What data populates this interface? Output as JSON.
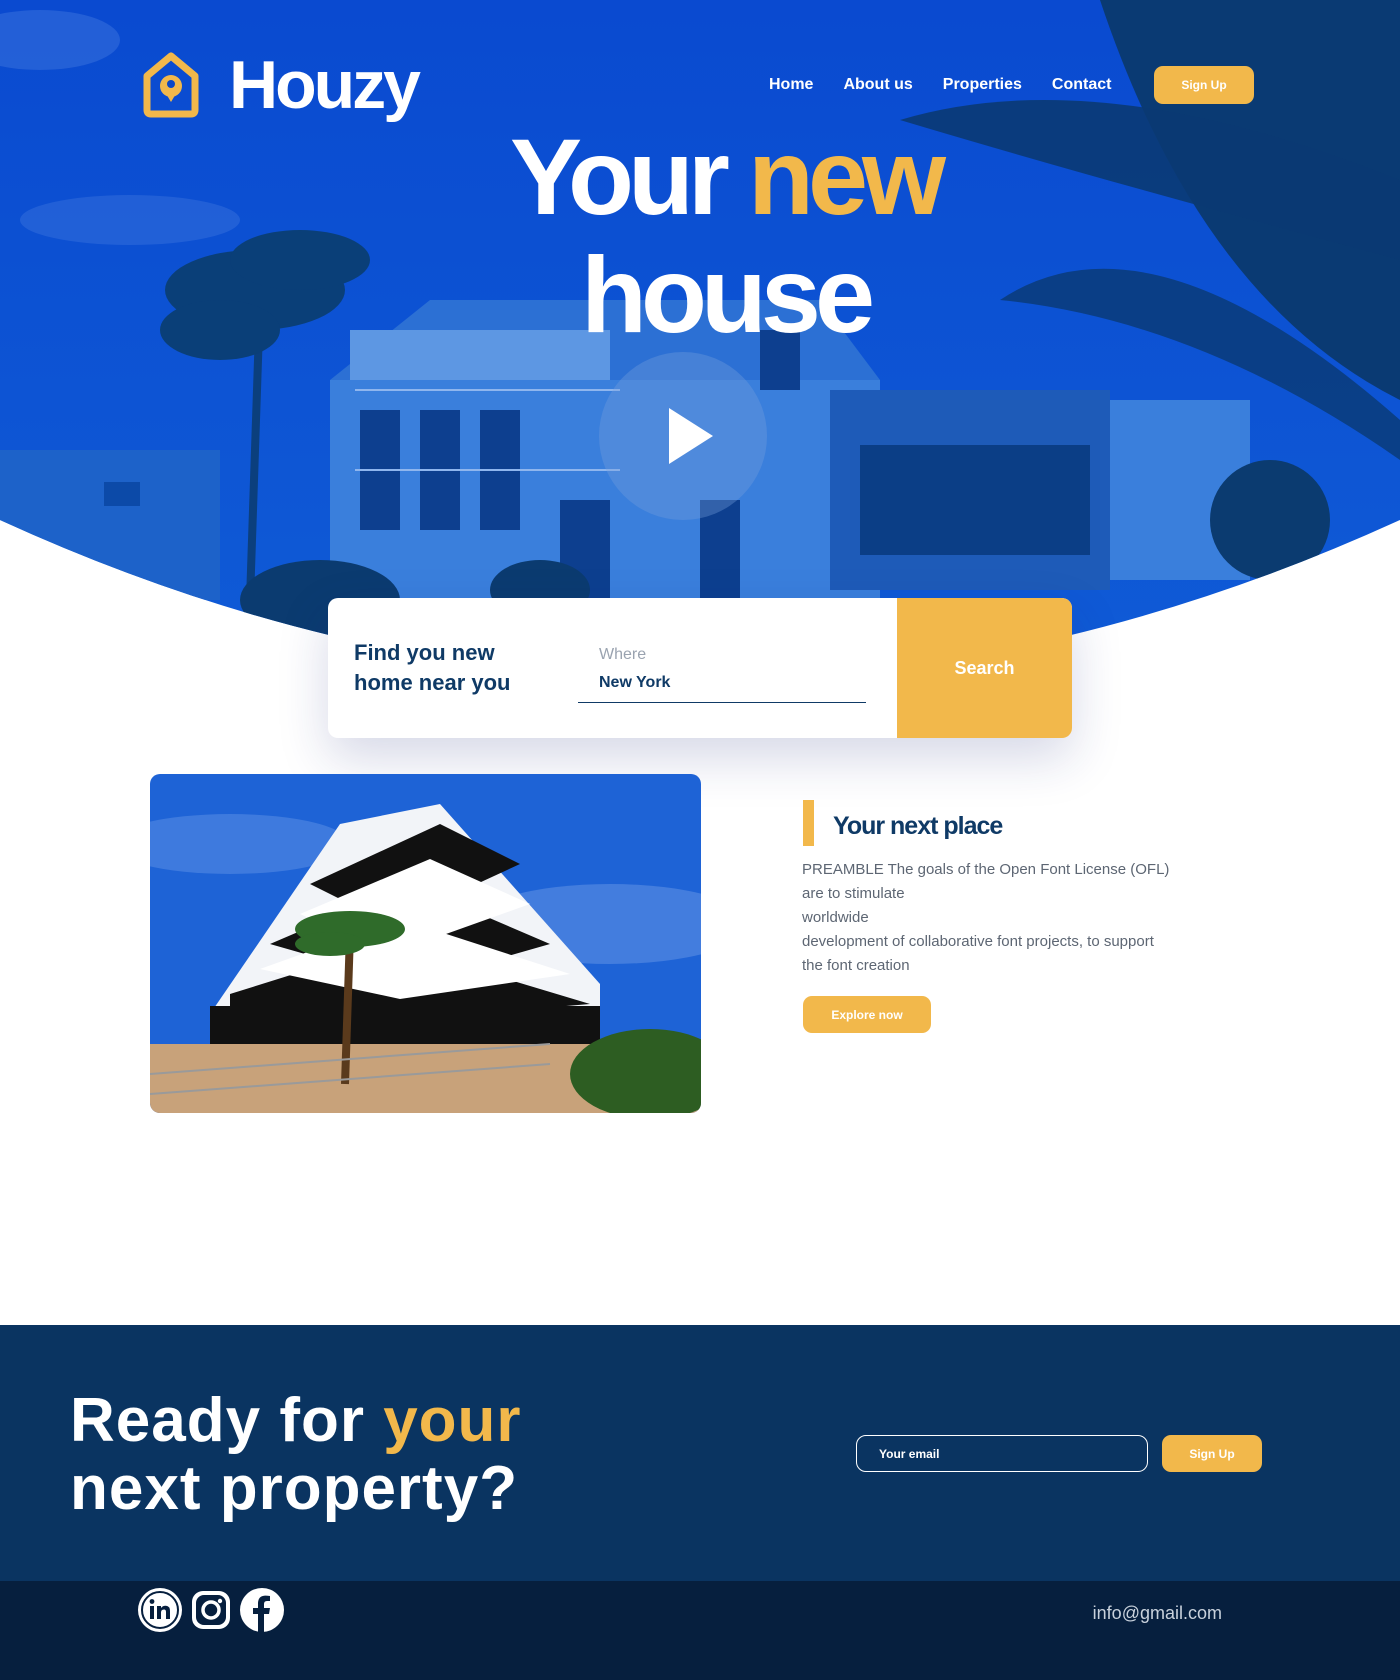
{
  "brand": {
    "name": "Houzy",
    "accent_color": "#f2b84b",
    "primary_blue": "#0a47c7",
    "dark_navy": "#0a3461",
    "footer_navy": "#061f3e"
  },
  "nav": {
    "items": [
      {
        "label": "Home"
      },
      {
        "label": "About us"
      },
      {
        "label": "Properties"
      },
      {
        "label": "Contact"
      }
    ],
    "signup_label": "Sign Up"
  },
  "hero": {
    "headline_part1": "Your",
    "headline_accent": "new",
    "headline_part2": "house",
    "play_icon": "play-icon"
  },
  "search": {
    "title": "Find you new home near you",
    "where_label": "Where",
    "where_value": "New York",
    "button_label": "Search"
  },
  "next_place": {
    "title": "Your next place",
    "body_lines": [
      "PREAMBLE The goals of the Open Font License (OFL)",
      "are to stimulate",
      "worldwide",
      "development of collaborative font projects, to support",
      "the font creation"
    ],
    "button_label": "Explore now"
  },
  "cta": {
    "headline_part1": "Ready for",
    "headline_accent": "your",
    "headline_part2": "next property?",
    "email_placeholder": "Your email",
    "signup_label": "Sign Up"
  },
  "footer": {
    "social_icons": [
      "linkedin-icon",
      "instagram-icon",
      "facebook-icon"
    ],
    "email": "info@gmail.com"
  }
}
